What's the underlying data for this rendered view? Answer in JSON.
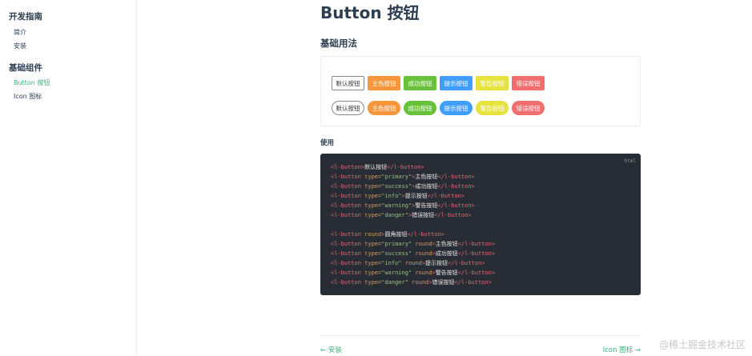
{
  "sidebar": {
    "groups": [
      {
        "title": "开发指南",
        "items": [
          {
            "label": "简介"
          },
          {
            "label": "安装"
          }
        ]
      },
      {
        "title": "基础组件",
        "items": [
          {
            "label": "Button 按钮",
            "active": true
          },
          {
            "label": "Icon 图标"
          }
        ]
      }
    ]
  },
  "page": {
    "title": "Button 按钮",
    "section_title": "基础用法",
    "use_title": "使用"
  },
  "demo": {
    "rows": [
      [
        {
          "label": "默认按钮",
          "type": "default"
        },
        {
          "label": "主色按钮",
          "type": "primary"
        },
        {
          "label": "成功按钮",
          "type": "success"
        },
        {
          "label": "提示按钮",
          "type": "info"
        },
        {
          "label": "警告按钮",
          "type": "warning"
        },
        {
          "label": "错误按钮",
          "type": "danger"
        }
      ],
      [
        {
          "label": "默认按钮",
          "type": "default",
          "round": true
        },
        {
          "label": "主色按钮",
          "type": "primary",
          "round": true
        },
        {
          "label": "成功按钮",
          "type": "success",
          "round": true
        },
        {
          "label": "提示按钮",
          "type": "info",
          "round": true
        },
        {
          "label": "警告按钮",
          "type": "warning",
          "round": true
        },
        {
          "label": "错误按钮",
          "type": "danger",
          "round": true
        }
      ]
    ]
  },
  "colors": {
    "primary": "#f7963b",
    "success": "#67c23a",
    "info": "#409eff",
    "warning": "#e6e23e",
    "danger": "#f26d6d",
    "accent": "#3eaf7c",
    "code_bg": "#282c34"
  },
  "code": {
    "lang": "html",
    "lines": [
      "<l-button>默认按钮</l-button>",
      "<l-button type=\"primary\">主色按钮</l-button>",
      "<l-button type=\"success\">成功按钮</l-button>",
      "<l-button type=\"info\">提示按钮</l-button>",
      "<l-button type=\"warning\">警告按钮</l-button>",
      "<l-button type=\"danger\">错误按钮</l-button>",
      "",
      "<l-button round>圆角按钮</l-button>",
      "<l-button type=\"primary\" round>主色按钮</l-button>",
      "<l-button type=\"success\" round>成功按钮</l-button>",
      "<l-button type=\"info\" round>提示按钮</l-button>",
      "<l-button type=\"warning\" round>警告按钮</l-button>",
      "<l-button type=\"danger\" round>错误按钮</l-button>"
    ]
  },
  "nav": {
    "prev": "← 安装",
    "next": "Icon 图标 →"
  },
  "watermark": "@稀土掘金技术社区"
}
